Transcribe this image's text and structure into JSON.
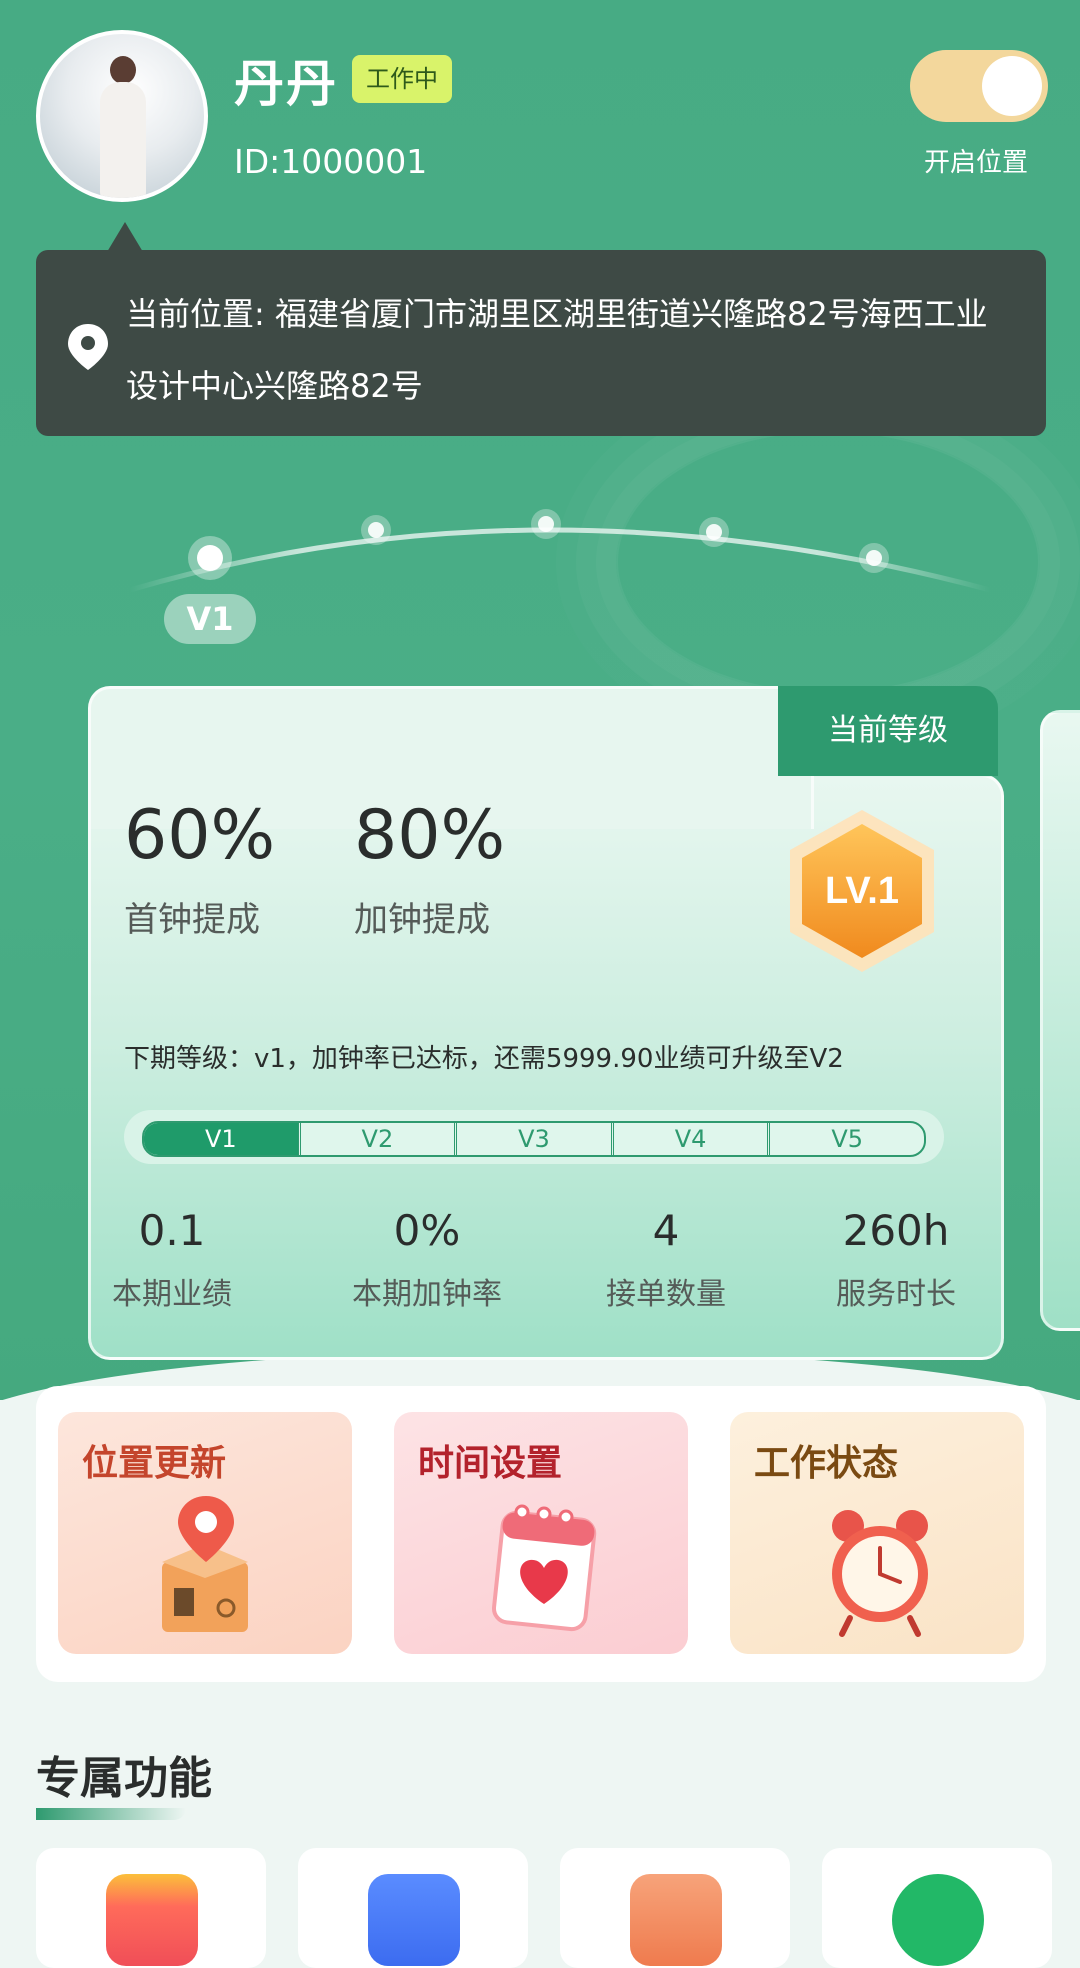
{
  "header": {
    "name": "丹丹",
    "status": "工作中",
    "id_text": "ID:1000001",
    "toggle_label": "开启位置",
    "toggle_on": true
  },
  "location": {
    "text": "当前位置: 福建省厦门市湖里区湖里街道兴隆路82号海西工业设计中心兴隆路82号"
  },
  "level_path": {
    "current": "V1",
    "current_index": 0
  },
  "level_card": {
    "tab_label": "当前等级",
    "first_rate": "60%",
    "first_rate_label": "首钟提成",
    "extra_rate": "80%",
    "extra_rate_label": "加钟提成",
    "badge": "LV.1",
    "next_text": "下期等级：v1，加钟率已达标，还需5999.90业绩可升级至V2",
    "levels": [
      "V1",
      "V2",
      "V3",
      "V4",
      "V5"
    ],
    "active_level": "V1",
    "stats": [
      {
        "value": "0.1",
        "label": "本期业绩"
      },
      {
        "value": "0%",
        "label": "本期加钟率"
      },
      {
        "value": "4",
        "label": "接单数量"
      },
      {
        "value": "260h",
        "label": "服务时长"
      }
    ]
  },
  "quick_actions": [
    {
      "label": "位置更新",
      "icon": "location-box-icon",
      "color": "#c4452c"
    },
    {
      "label": "时间设置",
      "icon": "heart-calendar-icon",
      "color": "#b3222c"
    },
    {
      "label": "工作状态",
      "icon": "alarm-clock-icon",
      "color": "#7a4a12"
    }
  ],
  "section": {
    "title": "专属功能"
  },
  "features": [
    {
      "icon": "red-app-icon"
    },
    {
      "icon": "blue-calendar-icon"
    },
    {
      "icon": "orange-card-icon"
    },
    {
      "icon": "green-chat-icon"
    }
  ],
  "colors": {
    "primary": "#47ab84",
    "dark_bubble": "#3e4a45",
    "badge_yellow": "#d9f36a",
    "toggle": "#f3d79c",
    "level_tab": "#2e9a6f"
  }
}
